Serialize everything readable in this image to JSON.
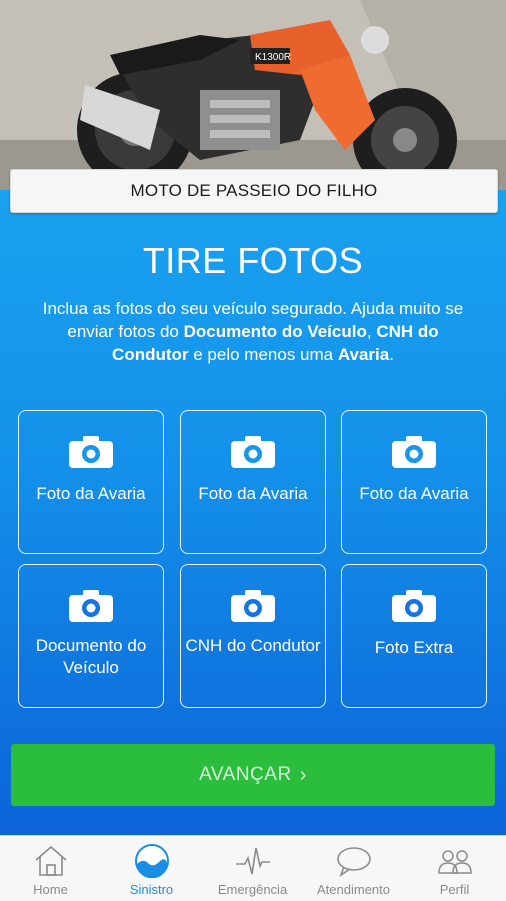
{
  "hero": {
    "image": "motorcycle-photo",
    "plate_text": "K1300R"
  },
  "vehicle": {
    "name": "MOTO DE PASSEIO DO FILHO"
  },
  "title": "TIRE FOTOS",
  "description": {
    "p1": "Inclua as fotos do seu veículo segurado. Ajuda muito se enviar fotos do ",
    "b1": "Documento do Veículo",
    "p2": ", ",
    "b2": "CNH do Condutor",
    "p3": " e pelo menos uma ",
    "b3": "Avaria",
    "p4": "."
  },
  "photo_cards": [
    {
      "label": "Foto da Avaria",
      "icon": "camera-icon"
    },
    {
      "label": "Foto da Avaria",
      "icon": "camera-icon"
    },
    {
      "label": "Foto da Avaria",
      "icon": "camera-icon"
    },
    {
      "label": "Documento do Veículo",
      "icon": "camera-icon"
    },
    {
      "label": "CNH do Condutor",
      "icon": "camera-icon"
    },
    {
      "label": "Foto Extra",
      "icon": "camera-icon"
    }
  ],
  "next_button": {
    "label": "AVANÇAR",
    "arrow": "›"
  },
  "tabs": [
    {
      "label": "Home",
      "icon": "home-icon",
      "active": false
    },
    {
      "label": "Sinistro",
      "icon": "wave-icon",
      "active": true
    },
    {
      "label": "Emergência",
      "icon": "heartbeat-icon",
      "active": false
    },
    {
      "label": "Atendimento",
      "icon": "chat-bubble-icon",
      "active": false
    },
    {
      "label": "Perfil",
      "icon": "people-icon",
      "active": false
    }
  ],
  "colors": {
    "accent": "#1a8ee6",
    "button": "#2bbd3c",
    "gradient_top": "#1aa2ef",
    "gradient_bottom": "#0c63d8"
  }
}
